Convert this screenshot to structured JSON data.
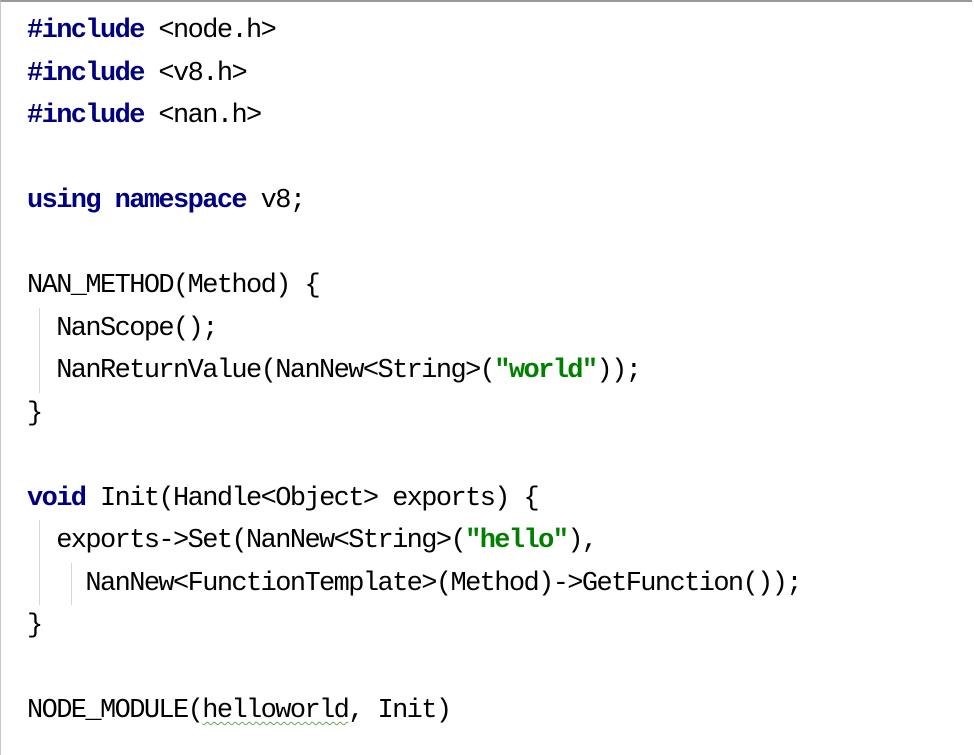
{
  "editor": {
    "lines": [
      {
        "kw": "#include",
        "rest": " <node.h>"
      },
      {
        "kw": "#include",
        "rest": " <v8.h>"
      },
      {
        "kw": "#include",
        "rest": " <nan.h>"
      },
      {
        "blank": true
      },
      {
        "kw": "using namespace",
        "rest": " v8;"
      },
      {
        "blank": true
      },
      {
        "text": "NAN_METHOD(Method) {"
      },
      {
        "text": "  NanScope();"
      },
      {
        "pre": "  NanReturnValue(NanNew<String>(",
        "str": "\"world\"",
        "post": "));"
      },
      {
        "text": "}"
      },
      {
        "blank": true
      },
      {
        "kw": "void",
        "rest": " Init(Handle<Object> exports) {"
      },
      {
        "pre": "  exports->Set(NanNew<String>(",
        "str": "\"hello\"",
        "post": "),"
      },
      {
        "text": "    NanNew<FunctionTemplate>(Method)->GetFunction());"
      },
      {
        "text": "}"
      },
      {
        "blank": true
      },
      {
        "pre": "NODE_MODULE(",
        "squiggle": "helloworld",
        "post": ", Init)"
      }
    ]
  }
}
